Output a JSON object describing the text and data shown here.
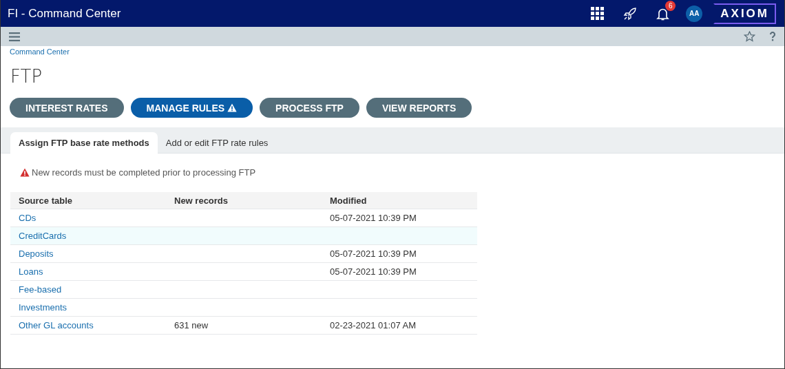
{
  "window": {
    "title": "FI - Command Center"
  },
  "header": {
    "notification_count": "6",
    "avatar": "AA",
    "logo": "AXIOM"
  },
  "breadcrumb": "Command Center",
  "page_title": "FTP",
  "actions": [
    {
      "label": "INTEREST RATES",
      "selected": false,
      "warning": false
    },
    {
      "label": "MANAGE RULES",
      "selected": true,
      "warning": true
    },
    {
      "label": "PROCESS FTP",
      "selected": false,
      "warning": false
    },
    {
      "label": "VIEW REPORTS",
      "selected": false,
      "warning": false
    }
  ],
  "tabs": [
    {
      "label": "Assign FTP base rate methods",
      "selected": true
    },
    {
      "label": "Add or edit FTP rate rules",
      "selected": false
    }
  ],
  "alert": "New records must be completed prior to processing FTP",
  "table": {
    "columns": [
      "Source table",
      "New records",
      "Modified"
    ],
    "rows": [
      {
        "source": "CDs",
        "modified": "05-07-2021 10:39 PM",
        "highlighted": false
      },
      {
        "source": "CreditCards",
        "highlighted": true
      },
      {
        "source": "Deposits",
        "modified": "05-07-2021 10:39 PM",
        "highlighted": false
      },
      {
        "source": "Loans",
        "modified": "05-07-2021 10:39 PM",
        "highlighted": false
      },
      {
        "source": "Fee-based",
        "highlighted": false
      },
      {
        "source": "Investments",
        "highlighted": false
      },
      {
        "source": "Other GL accounts",
        "new_records": "631 new",
        "modified": "02-23-2021 01:07 AM",
        "highlighted": false
      }
    ]
  }
}
